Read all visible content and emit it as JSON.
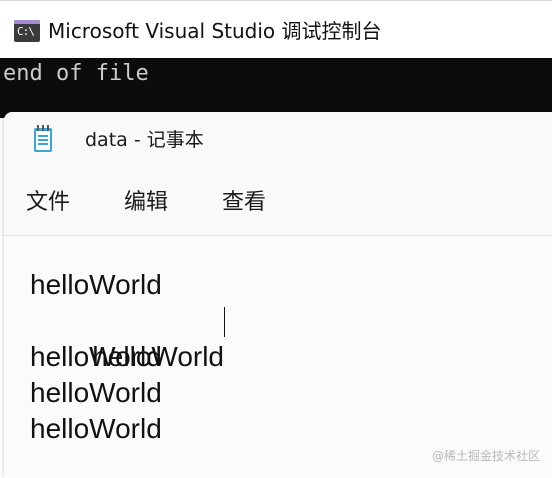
{
  "console": {
    "title": "Microsoft Visual Studio 调试控制台",
    "icon_text": "C:\\",
    "output": "end of file"
  },
  "notepad": {
    "title": "data - 记事本",
    "menu": [
      "文件",
      "编辑",
      "查看"
    ],
    "lines": [
      "helloWorld",
      "helloWorld",
      "helloWorld",
      "helloWorld",
      "helloWorld"
    ]
  },
  "watermark": "@稀土掘金技术社区",
  "colors": {
    "console_background": "#0c0c0c",
    "console_text": "#cccccc",
    "notepad_background": "#f9f9f9",
    "icon_accent": "#a58bd6"
  }
}
